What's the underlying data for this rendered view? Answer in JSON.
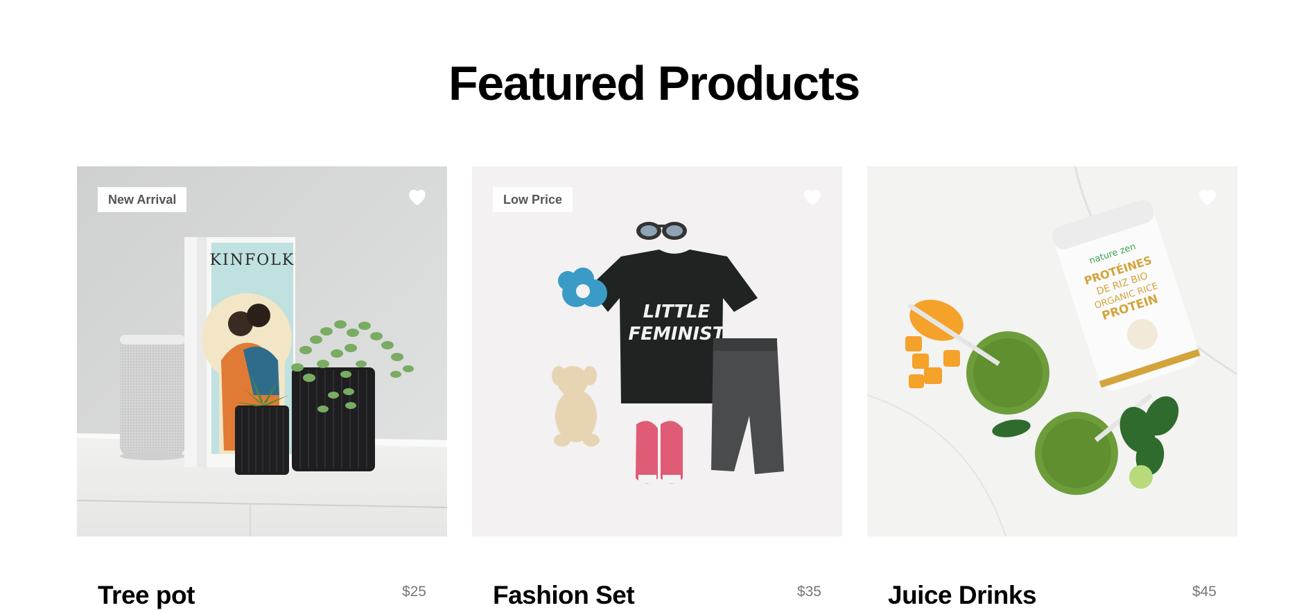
{
  "section": {
    "title": "Featured Products"
  },
  "products": [
    {
      "name": "Tree pot",
      "price": "$25",
      "badge": "New Arrival",
      "favorite_icon": "heart-icon",
      "image": "home-decor-photo"
    },
    {
      "name": "Fashion Set",
      "price": "$35",
      "badge": "Low Price",
      "favorite_icon": "heart-icon",
      "image": "kids-outfit-photo"
    },
    {
      "name": "Juice Drinks",
      "price": "$45",
      "badge": "",
      "favorite_icon": "heart-icon",
      "image": "green-juice-photo"
    }
  ],
  "photo_text": {
    "magazine": "KINFOLK",
    "tshirt_line1": "LITTLE",
    "tshirt_line2": "FEMINIST",
    "jar_brand": "nature zen",
    "jar_line1": "PROTÉINES",
    "jar_line2": "DE RIZ BIO",
    "jar_line3": "ORGANIC RICE",
    "jar_line4": "PROTEIN"
  },
  "colors": {
    "badge_text": "#555555",
    "price_text": "#777777",
    "heart": "#ffffff"
  }
}
